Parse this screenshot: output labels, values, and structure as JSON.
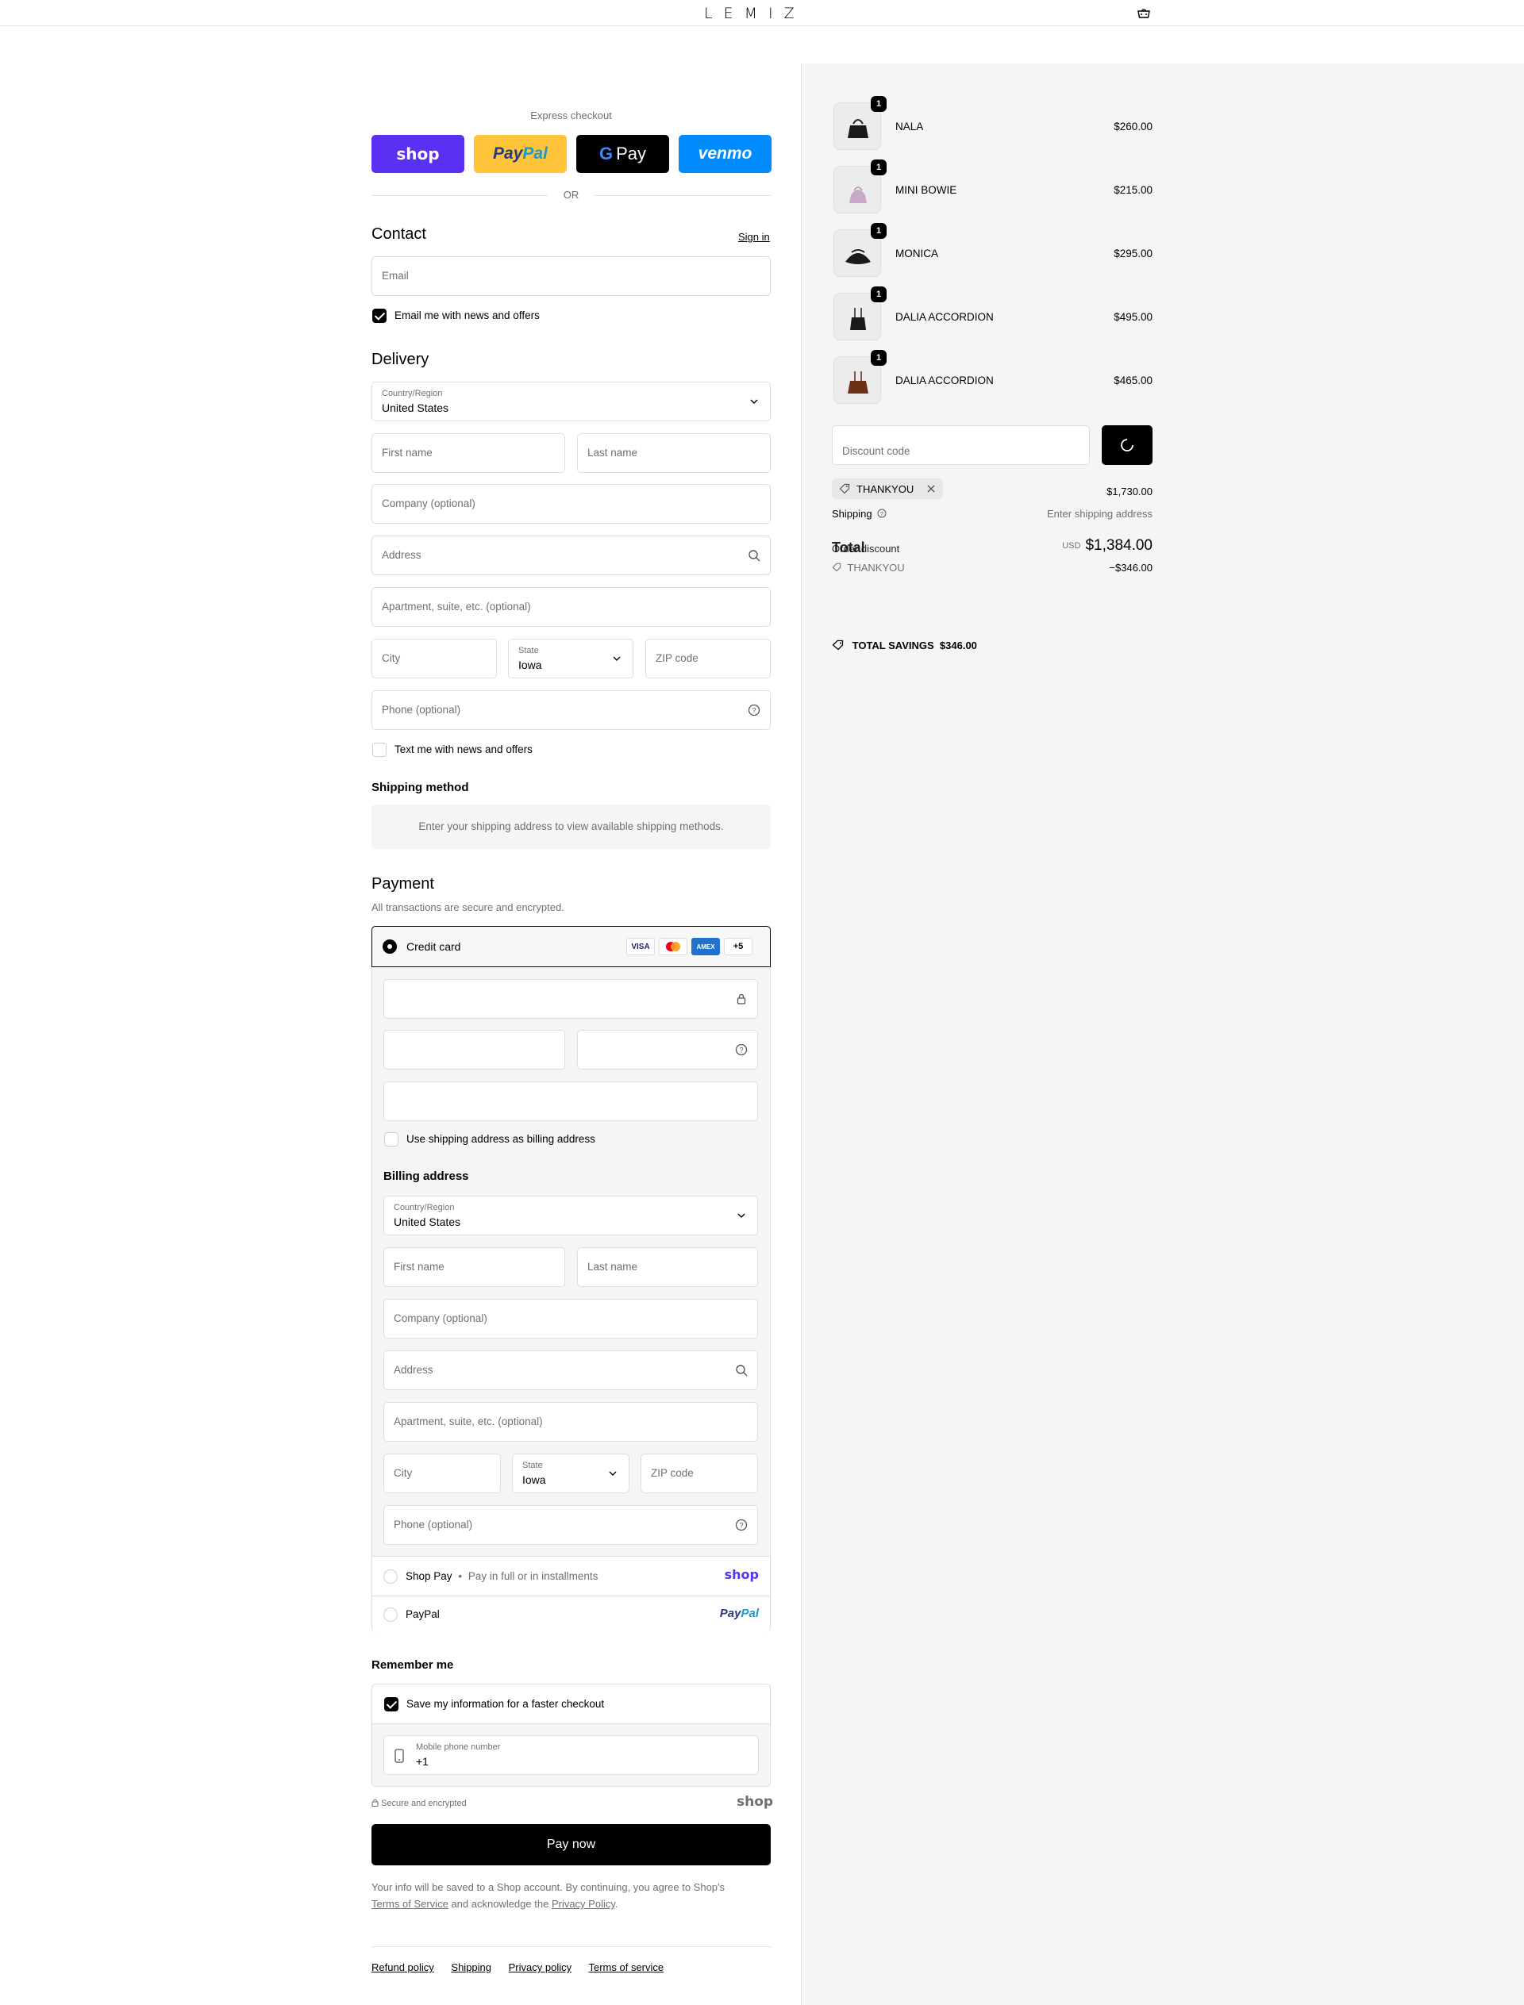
{
  "brand": "LEMIZ",
  "express": {
    "title": "Express checkout",
    "shop": "shop",
    "paypal_a": "Pay",
    "paypal_b": "Pal",
    "gpay": "Pay",
    "venmo": "venmo",
    "or": "OR"
  },
  "contact": {
    "title": "Contact",
    "signin": "Sign in",
    "email_placeholder": "Email",
    "news_label": "Email me with news and offers",
    "news_checked": true
  },
  "delivery": {
    "title": "Delivery",
    "country_label": "Country/Region",
    "country_value": "United States",
    "first_name": "First name",
    "last_name": "Last name",
    "company": "Company (optional)",
    "address": "Address",
    "apartment": "Apartment, suite, etc. (optional)",
    "city": "City",
    "state_label": "State",
    "state_value": "Iowa",
    "zip": "ZIP code",
    "phone": "Phone (optional)",
    "text_label": "Text me with news and offers"
  },
  "shipping_method": {
    "title": "Shipping method",
    "message": "Enter your shipping address to view available shipping methods."
  },
  "payment": {
    "title": "Payment",
    "subtitle": "All transactions are secure and encrypted.",
    "credit_card": "Credit card",
    "more_cards": "+5",
    "visa": "VISA",
    "same_billing": "Use shipping address as billing address",
    "billing_title": "Billing address",
    "shop_pay": "Shop Pay",
    "shop_pay_sub": "Pay in full or in installments",
    "shop_logo": "shop",
    "paypal": "PayPal",
    "paypal_logo_a": "Pay",
    "paypal_logo_b": "Pal"
  },
  "billing": {
    "country_label": "Country/Region",
    "country_value": "United States",
    "first_name": "First name",
    "last_name": "Last name",
    "company": "Company (optional)",
    "address": "Address",
    "apartment": "Apartment, suite, etc. (optional)",
    "city": "City",
    "state_label": "State",
    "state_value": "Iowa",
    "zip": "ZIP code",
    "phone": "Phone (optional)"
  },
  "remember": {
    "title": "Remember me",
    "save_label": "Save my information for a faster checkout",
    "mobile_label": "Mobile phone number",
    "mobile_value": "+1",
    "secure": "Secure and encrypted",
    "shop_logo": "shop"
  },
  "pay_now": "Pay now",
  "legal": {
    "text1": "Your info will be saved to a Shop account. By continuing, you agree to Shop's",
    "terms": "Terms of Service",
    "text2": "and acknowledge the",
    "privacy": "Privacy Policy",
    "text3": "."
  },
  "footer": [
    "Refund policy",
    "Shipping",
    "Privacy policy",
    "Terms of service"
  ],
  "items": [
    {
      "name": "NALA",
      "price": "$260.00",
      "qty": "1"
    },
    {
      "name": "MINI BOWIE",
      "price": "$215.00",
      "qty": "1"
    },
    {
      "name": "MONICA",
      "price": "$295.00",
      "qty": "1"
    },
    {
      "name": "DALIA ACCORDION",
      "price": "$495.00",
      "qty": "1"
    },
    {
      "name": "DALIA ACCORDION",
      "price": "$465.00",
      "qty": "1"
    }
  ],
  "summary": {
    "discount_placeholder": "Discount code",
    "code": "THANKYOU",
    "subtotal": "$1,730.00",
    "shipping_label": "Shipping",
    "shipping_value": "Enter shipping address",
    "total_label": "Total",
    "order_discount": "Order discount",
    "currency": "USD",
    "total": "$1,384.00",
    "discount_code": "THANKYOU",
    "discount_value": "−$346.00",
    "savings_label": "TOTAL SAVINGS",
    "savings_value": "$346.00"
  }
}
